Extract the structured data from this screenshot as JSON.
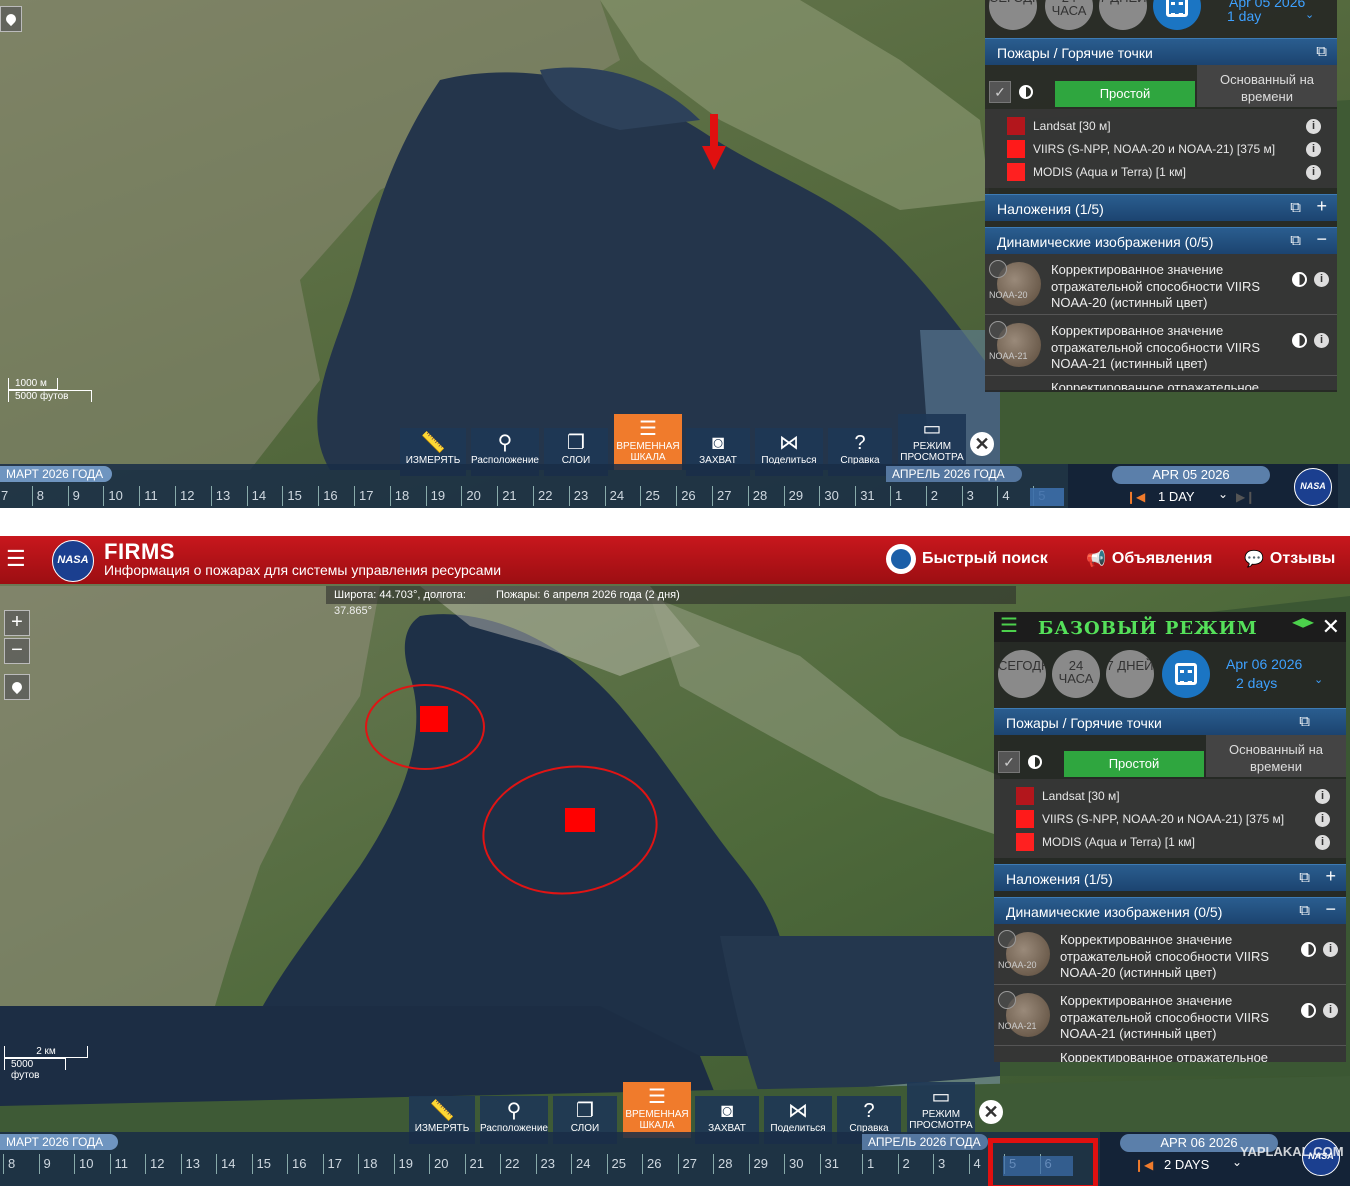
{
  "header": {
    "logo_text": "NASA",
    "app_name": "FIRMS",
    "subtitle": "Информация о пожарах для системы управления ресурсами",
    "quick_search": "Быстрый поиск",
    "announcements": "Объявления",
    "feedback": "Отзывы"
  },
  "infobar": {
    "latlon": "Широта: 44.703°, долгота:",
    "lon_value": "37.865°",
    "fires": "Пожары: 6 апреля 2026 года (2 дня)"
  },
  "zoom": {
    "plus": "+",
    "minus": "−"
  },
  "scale_top": {
    "metric": "1000 м",
    "imperial": "5000 футов"
  },
  "scale_bottom": {
    "metric": "2 км",
    "imperial": "5000 футов"
  },
  "panel": {
    "mode_title": "БАЗОВЫЙ РЕЖИМ",
    "today": "СЕГОДНЯ",
    "h24": "24 ЧАСА",
    "d7": "7 ДНЕЙ",
    "top_date": "Apr 05 2026",
    "top_range": "1 day",
    "bottom_date": "Apr 06 2026",
    "bottom_range": "2 days",
    "fires_header": "Пожары / Горячие точки",
    "tab_simple": "Простой",
    "tab_time": "Основанный на времени",
    "layers": [
      {
        "name": "Landsat [30 м]",
        "color": "#b3161c"
      },
      {
        "name": "VIIRS (S-NPP, NOAA-20 и NOAA-21) [375 м]",
        "color": "#ff1a1a"
      },
      {
        "name": "MODIS (Aqua и Terra) [1 км]",
        "color": "#ff2020"
      }
    ],
    "overlays_header": "Наложения (1/5)",
    "dynamic_header": "Динамические изображения (0/5)",
    "dynamic": [
      {
        "tag": "NOAA-20",
        "text": "Корректированное значение отражательной способности VIIRS NOAA-20 (истинный цвет)"
      },
      {
        "tag": "NOAA-21",
        "text": "Корректированное значение отражательной способности VIIRS NOAA-21 (истинный цвет)"
      },
      {
        "tag": "",
        "text": "Корректированное отражательное"
      }
    ]
  },
  "toolbar": {
    "measure": "ИЗМЕРЯТЬ",
    "location": "Расположение",
    "layers": "СЛОИ",
    "timeline_1": "ВРЕМЕННАЯ",
    "timeline_2": "ШКАЛА",
    "capture": "ЗАХВАТ",
    "share": "Поделиться",
    "help": "Справка",
    "view_1": "РЕЖИМ",
    "view_2": "ПРОСМОТРА",
    "close": "✕"
  },
  "timeline": {
    "march": "МАРТ 2026 ГОДА",
    "april": "АПРЕЛЬ 2026 ГОДА",
    "march_days": [
      "7",
      "8",
      "9",
      "10",
      "11",
      "12",
      "13",
      "14",
      "15",
      "16",
      "17",
      "18",
      "19",
      "20",
      "21",
      "22",
      "23",
      "24",
      "25",
      "26",
      "27",
      "28",
      "29",
      "30",
      "31"
    ],
    "april_days_top": [
      "1",
      "2",
      "3",
      "4",
      "5"
    ],
    "april_days_bottom": [
      "1",
      "2",
      "3",
      "4",
      "5",
      "6"
    ],
    "top_date": "APR 05 2026",
    "top_interval": "1 DAY",
    "bottom_date": "APR 06 2026",
    "bottom_interval": "2 DAYS"
  },
  "watermark": "YAPLAKAL.COM",
  "colors": {
    "firms_red": "#b5121b",
    "accent_orange": "#f07b2c",
    "panel_blue": "#1c4470",
    "hotspot": "#ff0000"
  }
}
